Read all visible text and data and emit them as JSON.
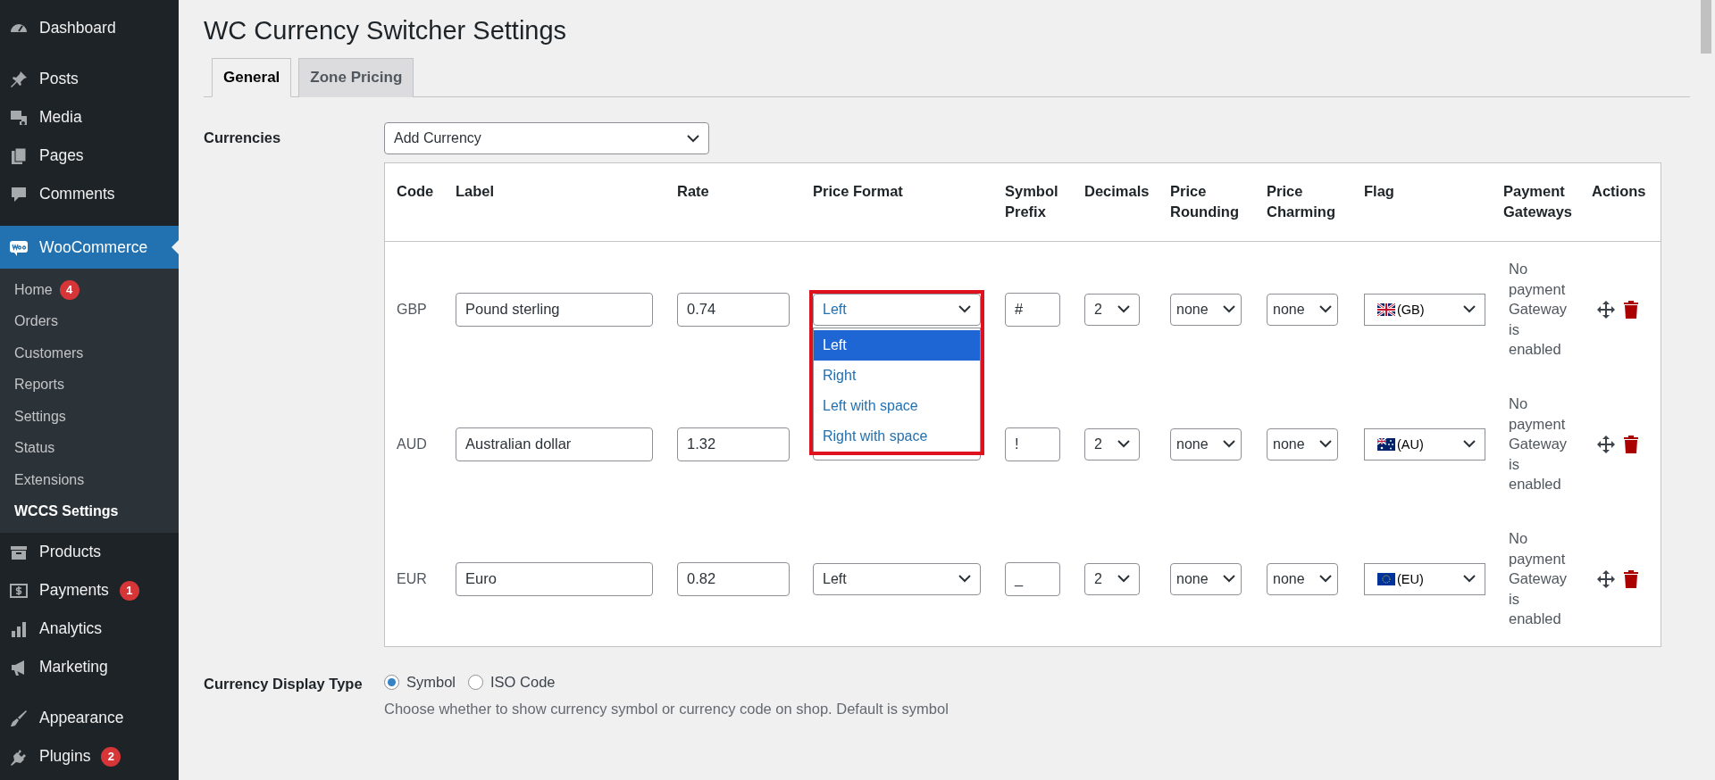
{
  "sidebar": {
    "groups": [
      {
        "items": [
          {
            "label": "Dashboard",
            "selected": false
          }
        ]
      },
      {
        "items": [
          {
            "label": "Posts",
            "selected": false
          },
          {
            "label": "Media",
            "selected": false
          },
          {
            "label": "Pages",
            "selected": false
          },
          {
            "label": "Comments",
            "selected": false
          }
        ]
      },
      {
        "items": [
          {
            "label": "WooCommerce",
            "selected": true,
            "expanded": true,
            "children": [
              {
                "label": "Home",
                "badge": "4",
                "selected": false
              },
              {
                "label": "Orders",
                "selected": false
              },
              {
                "label": "Customers",
                "selected": false
              },
              {
                "label": "Reports",
                "selected": false
              },
              {
                "label": "Settings",
                "selected": false
              },
              {
                "label": "Status",
                "selected": false
              },
              {
                "label": "Extensions",
                "selected": false
              },
              {
                "label": "WCCS Settings",
                "selected": true
              }
            ]
          },
          {
            "label": "Products",
            "selected": false
          },
          {
            "label": "Payments",
            "badge": "1",
            "selected": false
          },
          {
            "label": "Analytics",
            "selected": false
          },
          {
            "label": "Marketing",
            "selected": false
          }
        ]
      },
      {
        "items": [
          {
            "label": "Appearance",
            "selected": false
          },
          {
            "label": "Plugins",
            "badge": "2",
            "selected": false
          }
        ]
      }
    ]
  },
  "page": {
    "title": "WC Currency Switcher Settings"
  },
  "tabs": [
    {
      "label": "General",
      "selected": true
    },
    {
      "label": "Zone Pricing",
      "selected": false
    }
  ],
  "currencies": {
    "label": "Currencies",
    "add_select": "Add Currency",
    "table": {
      "columns": [
        "Code",
        "Label",
        "Rate",
        "Price Format",
        "Symbol Prefix",
        "Decimals",
        "Price Rounding",
        "Price Charming",
        "Flag",
        "Payment Gateways",
        "Actions"
      ],
      "rows": [
        {
          "code": "GBP",
          "label": "Pound sterling",
          "rate": "0.74",
          "price_format": "Left",
          "symbol_prefix": "#",
          "decimals": "2",
          "price_rounding": "none",
          "price_charming": "none",
          "flag": {
            "kind": "gb",
            "label": "(GB)"
          },
          "payment_gateways": "No payment Gateway is enabled",
          "dropdown": {
            "highlighted": true,
            "options": [
              {
                "label": "Left",
                "selected": true
              },
              {
                "label": "Right",
                "selected": false
              },
              {
                "label": "Left with space",
                "selected": false
              },
              {
                "label": "Right with space",
                "selected": false
              }
            ]
          }
        },
        {
          "code": "AUD",
          "label": "Australian dollar",
          "rate": "1.32",
          "symbol_prefix": "!",
          "decimals": "2",
          "price_rounding": "none",
          "price_charming": "none",
          "flag": {
            "kind": "au",
            "label": "(AU)"
          },
          "payment_gateways": "No payment Gateway is enabled"
        },
        {
          "code": "EUR",
          "label": "Euro",
          "rate": "0.82",
          "price_format": "Left",
          "symbol_prefix": "_",
          "decimals": "2",
          "price_rounding": "none",
          "price_charming": "none",
          "flag": {
            "kind": "eu",
            "label": "(EU)"
          },
          "payment_gateways": "No payment Gateway is enabled"
        }
      ]
    }
  },
  "display_type": {
    "label": "Currency Display Type",
    "options": [
      {
        "label": "Symbol",
        "selected": true
      },
      {
        "label": "ISO Code",
        "selected": false
      }
    ],
    "help": "Choose whether to show currency symbol or currency code on shop. Default is symbol"
  }
}
